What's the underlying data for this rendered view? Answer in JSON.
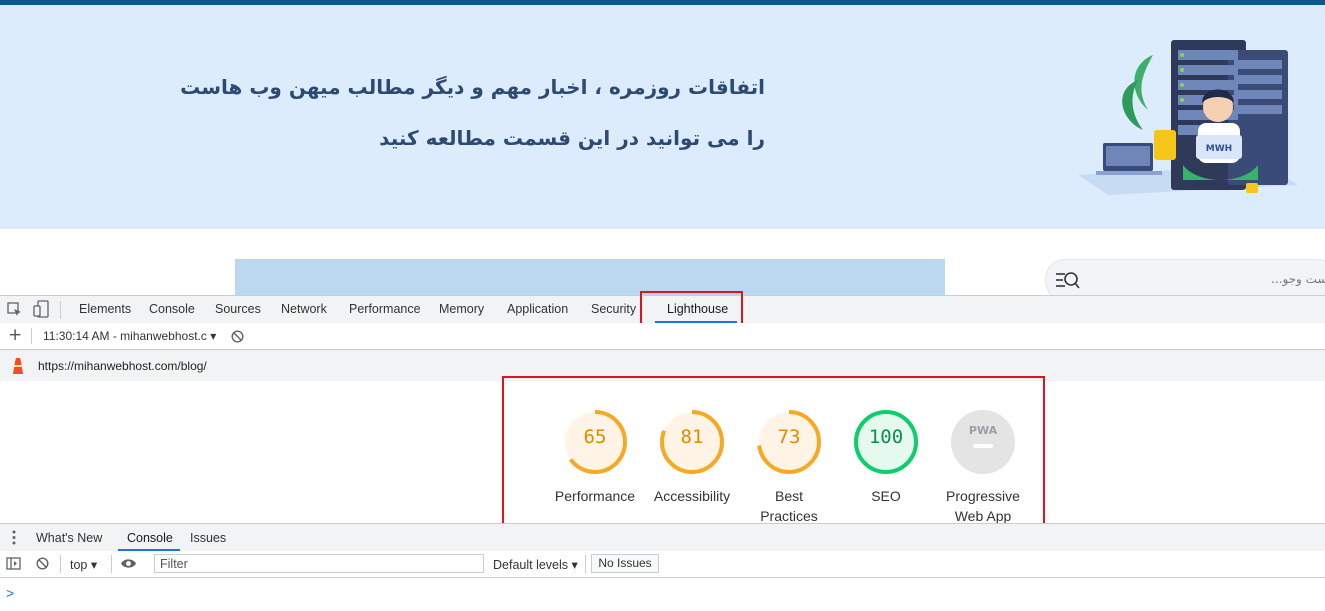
{
  "hero": {
    "line1": "اتفاقات روزمره ، اخبار مهم و دیگر مطالب میهن وب هاست",
    "line2": "را می توانید در این قسمت مطالعه کنید",
    "logo_text": "MWH"
  },
  "site_search": {
    "placeholder": "جست وجو...",
    "icon": "search-menu-icon"
  },
  "devtools": {
    "tabs": [
      "Elements",
      "Console",
      "Sources",
      "Network",
      "Performance",
      "Memory",
      "Application",
      "Security",
      "Lighthouse"
    ],
    "active_tab": "Lighthouse",
    "report_selector": "11:30:14 AM - mihanwebhost.c",
    "url": "https://mihanwebhost.com/blog/",
    "gauges": [
      {
        "label": "Performance",
        "score": "65",
        "color": "#f9a825",
        "fill": "#fff4e5",
        "value": 0.65
      },
      {
        "label": "Accessibility",
        "score": "81",
        "color": "#f9a825",
        "fill": "#fff4e5",
        "value": 0.81
      },
      {
        "label1": "Best",
        "label2": "Practices",
        "score": "73",
        "color": "#f9a825",
        "fill": "#fff4e5",
        "value": 0.73
      },
      {
        "label": "SEO",
        "score": "100",
        "color": "#0cce6b",
        "fill": "#e6f9ef",
        "value": 1.0
      },
      {
        "label1": "Progressive",
        "label2": "Web App",
        "score": "PWA",
        "color": "#dadce0",
        "fill": "#e4e4e4",
        "value": 0
      }
    ],
    "drawer": {
      "tabs": [
        "What's New",
        "Console",
        "Issues"
      ],
      "active_tab": "Console",
      "context": "top",
      "filter_placeholder": "Filter",
      "levels": "Default levels",
      "issues": "No Issues",
      "prompt": ">"
    }
  }
}
